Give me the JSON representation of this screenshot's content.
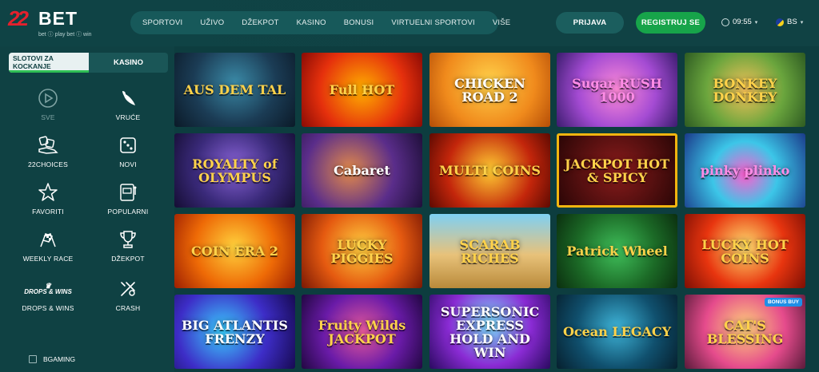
{
  "header": {
    "logo": {
      "mark": "22",
      "word": "BET",
      "tagline": "bet ⓘ play  bet ⓘ win"
    },
    "nav": [
      "SPORTOVI",
      "UŽIVO",
      "DŽEKPOT",
      "KASINO",
      "BONUSI",
      "VIRTUELNI SPORTOVI",
      "VIŠE"
    ],
    "login_label": "PRIJAVA",
    "register_label": "REGISTRUJ SE",
    "time": "09:55",
    "lang": "BS",
    "colors": {
      "accent": "#17a44a",
      "bg": "#0d3d3f"
    }
  },
  "sidebar": {
    "tabs": {
      "active": "SLOTOVI ZA KOCKANJE",
      "inactive": "KASINO"
    },
    "categories": [
      {
        "label": "SVE",
        "icon": "play-icon"
      },
      {
        "label": "VRUĆE",
        "icon": "chili-icon"
      },
      {
        "label": "22CHOICES",
        "icon": "dice-hand-icon"
      },
      {
        "label": "NOVI",
        "icon": "dice-icon"
      },
      {
        "label": "FAVORITI",
        "icon": "star-icon"
      },
      {
        "label": "POPULARNI",
        "icon": "slot-icon"
      },
      {
        "label": "WEEKLY RACE",
        "icon": "race-flags-icon"
      },
      {
        "label": "DŽEKPOT",
        "icon": "trophy-icon"
      },
      {
        "label": "DROPS & WINS",
        "icon": "drops-wins-icon",
        "logo_text": "DROPS & WINS"
      },
      {
        "label": "CRASH",
        "icon": "crash-icon"
      }
    ],
    "filter": {
      "label": "BGAMING",
      "checked": false
    }
  },
  "games": [
    {
      "title": "AUS DEM TAL"
    },
    {
      "title": "Full HOT"
    },
    {
      "title": "CHICKEN ROAD 2"
    },
    {
      "title": "Sugar RUSH 1000"
    },
    {
      "title": "BONKEY DONKEY"
    },
    {
      "title": "ROYALTY of OLYMPUS"
    },
    {
      "title": "Cabaret"
    },
    {
      "title": "MULTI COINS"
    },
    {
      "title": "JACKPOT HOT & SPICY"
    },
    {
      "title": "pinky plinko"
    },
    {
      "title": "COIN ERA 2"
    },
    {
      "title": "LUCKY PIGGIES"
    },
    {
      "title": "SCARAB RICHES"
    },
    {
      "title": "Patrick Wheel"
    },
    {
      "title": "LUCKY HOT COINS"
    },
    {
      "title": "BIG ATLANTIS FRENZY"
    },
    {
      "title": "Fruity Wilds JACKPOT"
    },
    {
      "title": "SUPERSONIC EXPRESS HOLD AND WIN"
    },
    {
      "title": "Ocean LEGACY"
    },
    {
      "title": "CAT'S BLESSING",
      "badge": "BONUS BUY"
    }
  ]
}
